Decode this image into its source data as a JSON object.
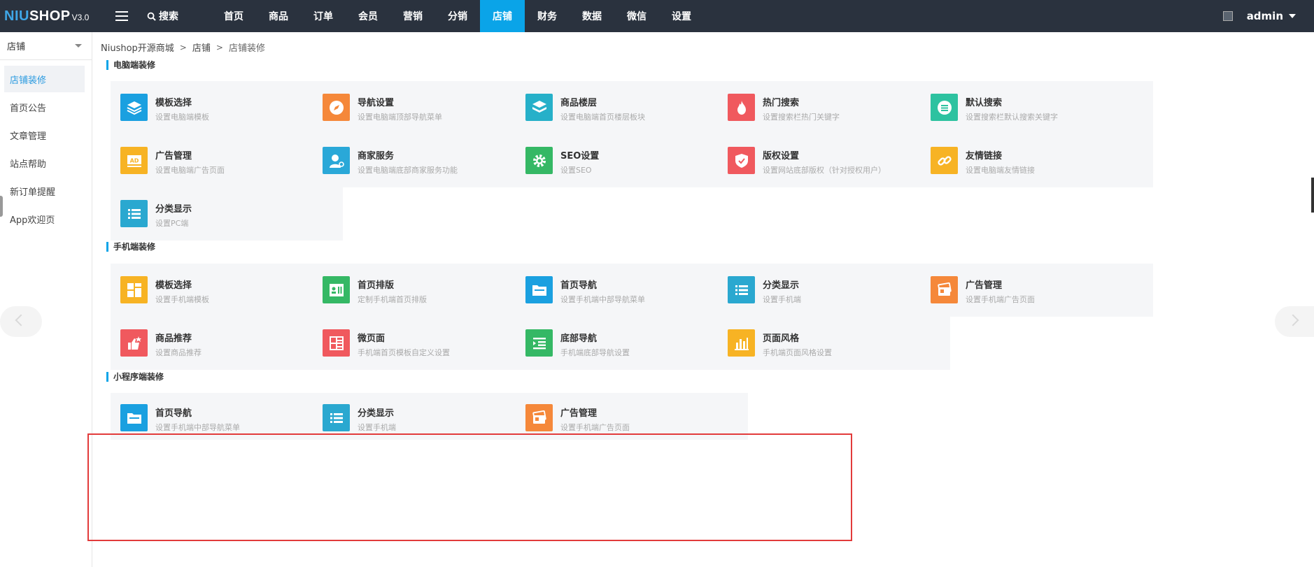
{
  "topbar": {
    "logo_part1": "NIU",
    "logo_part2": "SHOP",
    "version": "V3.0",
    "search_label": "搜索",
    "nav": [
      "首页",
      "商品",
      "订单",
      "会员",
      "营销",
      "分销",
      "店铺",
      "财务",
      "数据",
      "微信",
      "设置"
    ],
    "active_nav": "店铺",
    "user": "admin"
  },
  "sidebar": {
    "selector": "店铺",
    "items": [
      "店铺装修",
      "首页公告",
      "文章管理",
      "站点帮助",
      "新订单提醒",
      "App欢迎页"
    ],
    "active": "店铺装修"
  },
  "breadcrumb": [
    "Niushop开源商城",
    "店铺",
    "店铺装修"
  ],
  "sections": [
    {
      "title": "电脑端装修",
      "cards": [
        {
          "title": "模板选择",
          "desc": "设置电脑端模板",
          "icon": "layers-icon",
          "color": "#1aa0e0"
        },
        {
          "title": "导航设置",
          "desc": "设置电脑端顶部导航菜单",
          "icon": "compass-icon",
          "color": "#f5883a"
        },
        {
          "title": "商品楼层",
          "desc": "设置电脑端首页楼层板块",
          "icon": "stack-icon",
          "color": "#26b0c9"
        },
        {
          "title": "热门搜索",
          "desc": "设置搜索栏热门关键字",
          "icon": "fire-icon",
          "color": "#f0595e"
        },
        {
          "title": "默认搜索",
          "desc": "设置搜索栏默认搜索关键字",
          "icon": "search-list-icon",
          "color": "#2dc2a0"
        },
        {
          "title": "广告管理",
          "desc": "设置电脑端广告页面",
          "icon": "ad-icon",
          "color": "#f7b324"
        },
        {
          "title": "商家服务",
          "desc": "设置电脑端底部商家服务功能",
          "icon": "user-service-icon",
          "color": "#2aa8d8"
        },
        {
          "title": "SEO设置",
          "desc": "设置SEO",
          "icon": "gear-icon",
          "color": "#35b865"
        },
        {
          "title": "版权设置",
          "desc": "设置网站底部版权（针对授权用户）",
          "icon": "shield-icon",
          "color": "#f0595e"
        },
        {
          "title": "友情链接",
          "desc": "设置电脑端友情链接",
          "icon": "link-icon",
          "color": "#f7b324"
        },
        {
          "title": "分类显示",
          "desc": "设置PC端",
          "icon": "list-icon",
          "color": "#2aa8d0"
        }
      ]
    },
    {
      "title": "手机端装修",
      "cards": [
        {
          "title": "模板选择",
          "desc": "设置手机端模板",
          "icon": "grid-icon",
          "color": "#f7b324"
        },
        {
          "title": "首页排版",
          "desc": "定制手机端首页排版",
          "icon": "id-card-icon",
          "color": "#35b865"
        },
        {
          "title": "首页导航",
          "desc": "设置手机端中部导航菜单",
          "icon": "folder-icon",
          "color": "#1aa0e0"
        },
        {
          "title": "分类显示",
          "desc": "设置手机端",
          "icon": "list-icon",
          "color": "#2aa8d0"
        },
        {
          "title": "广告管理",
          "desc": "设置手机端广告页面",
          "icon": "cards-icon",
          "color": "#f5883a"
        },
        {
          "title": "商品推荐",
          "desc": "设置商品推荐",
          "icon": "thumbs-up-icon",
          "color": "#f0595e"
        },
        {
          "title": "微页面",
          "desc": "手机端首页模板自定义设置",
          "icon": "page-layout-icon",
          "color": "#f0595e"
        },
        {
          "title": "底部导航",
          "desc": "手机端底部导航设置",
          "icon": "indent-icon",
          "color": "#35b865"
        },
        {
          "title": "页面风格",
          "desc": "手机端页面风格设置",
          "icon": "bar-chart-icon",
          "color": "#f7b324"
        }
      ]
    },
    {
      "title": "小程序端装修",
      "cards": [
        {
          "title": "首页导航",
          "desc": "设置手机端中部导航菜单",
          "icon": "folder-icon",
          "color": "#1aa0e0"
        },
        {
          "title": "分类显示",
          "desc": "设置手机端",
          "icon": "list-icon",
          "color": "#2aa8d0"
        },
        {
          "title": "广告管理",
          "desc": "设置手机端广告页面",
          "icon": "cards-icon",
          "color": "#f5883a"
        }
      ]
    }
  ]
}
